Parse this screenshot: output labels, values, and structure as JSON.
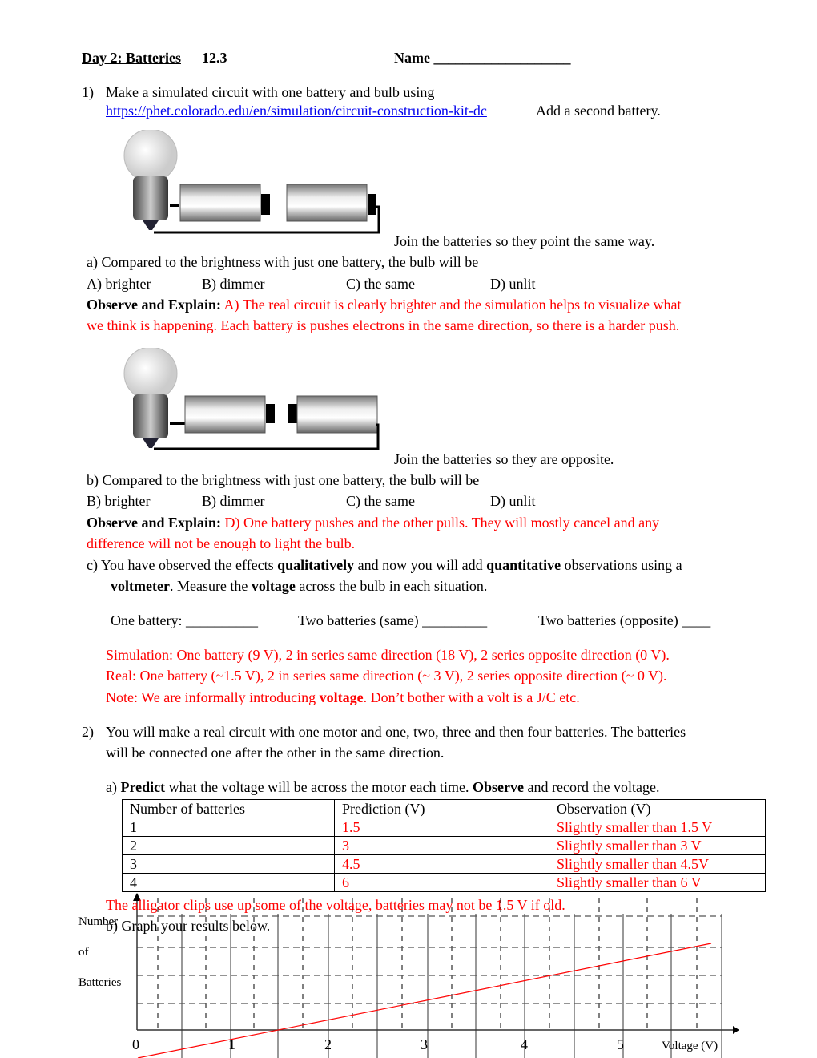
{
  "header": {
    "title": "Day 2: Batteries",
    "section": "12.3",
    "name_label": "Name ___________________"
  },
  "q1": {
    "num": "1)",
    "text": "Make a simulated circuit with one battery and bulb using",
    "link": "https://phet.colorado.edu/en/simulation/circuit-construction-kit-dc",
    "after_link": "Add a second battery.",
    "caption1": "Join the batteries so they point the same way.",
    "a": {
      "stem": "a)  Compared to the brightness with just one battery, the bulb will be",
      "options": [
        "A)  brighter",
        "B) dimmer",
        "C) the same",
        "D) unlit"
      ],
      "observe_label": "Observe and Explain:",
      "answer1": "A) The real circuit is clearly brighter and the simulation helps to visualize what",
      "answer2": "we think is happening. Each battery is pushes electrons in the same direction, so there is a harder push."
    },
    "caption2": "Join the batteries so they are opposite.",
    "b": {
      "stem": "b)  Compared to the brightness with just one battery, the bulb will be",
      "options": [
        "B)  brighter",
        "B) dimmer",
        "C) the same",
        "D) unlit"
      ],
      "observe_label": "Observe and Explain:",
      "answer1": "D) One battery pushes and the other pulls. They will mostly cancel and any",
      "answer2": "difference will not be enough to light the bulb."
    },
    "c": {
      "p1": "c)  You have observed the effects ",
      "w1": "qualitatively",
      "p2": " and now you will add ",
      "w2": "quantitative",
      "p3": " observations using a",
      "w3": "voltmeter",
      "p4": ". Measure the ",
      "w4": "voltage",
      "p5": " across the bulb in each situation.",
      "one": "One battery:  __________",
      "same": "Two batteries (same)  _________",
      "opposite": "Two batteries (opposite) ____",
      "sim": "Simulation: One battery (9 V), 2 in series same direction (18 V), 2 series opposite direction (0 V).",
      "real": "Real: One battery (~1.5 V), 2 in series same direction (~ 3 V), 2 series opposite direction (~ 0 V).",
      "note_a": "Note: We are informally introducing ",
      "note_b": "voltage",
      "note_c": ". Don’t bother with a volt is a J/C etc."
    }
  },
  "q2": {
    "num": "2)",
    "line1": "You will make a real circuit with one motor and one, two, three and then four batteries. The batteries",
    "line2": "will be connected one after the other in the same direction.",
    "a": {
      "p1": "a) ",
      "w1": "Predict",
      "p2": " what the voltage will be across the motor each time. ",
      "w2": "Observe",
      "p3": " and record the voltage."
    },
    "table": {
      "headers": [
        "Number of batteries",
        "Prediction (V)",
        "Observation (V)"
      ],
      "rows": [
        [
          "1",
          "1.5",
          "Slightly smaller than 1.5 V"
        ],
        [
          "2",
          "3",
          "Slightly smaller than 3 V"
        ],
        [
          "3",
          "4.5",
          "Slightly smaller than 4.5V"
        ],
        [
          "4",
          "6",
          "Slightly smaller than 6 V"
        ]
      ]
    },
    "note": "The alligator clips use up some of the voltage, batteries may not be 1.5 V if old.",
    "b": "b) Graph your results below.",
    "graph": {
      "ylabel": [
        "Number",
        "of",
        "Batteries"
      ],
      "xlabel": "Voltage (V)",
      "xticks": [
        "0",
        "1",
        "2",
        "3",
        "4",
        "5"
      ],
      "line_color": "#ff0000"
    }
  }
}
